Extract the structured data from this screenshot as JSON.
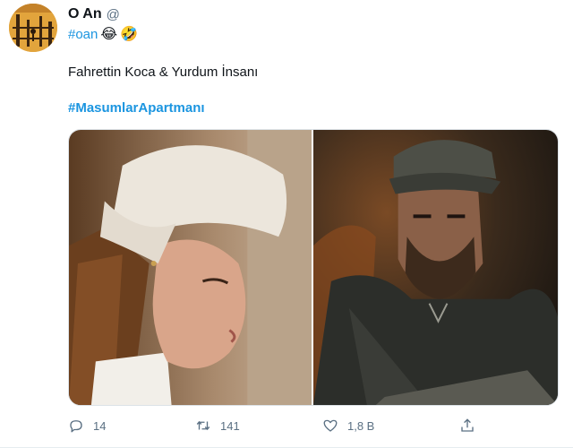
{
  "tweet": {
    "author": {
      "display_name": "O An",
      "handle": "@"
    },
    "header_hashtag": "#oan",
    "emojis": [
      "😂",
      "🤣"
    ],
    "text": "Fahrettin Koca & Yurdum İnsanı",
    "hashtag": "#MasumlarApartmanı",
    "actions": {
      "reply_count": "14",
      "retweet_count": "141",
      "like_count": "1,8 B"
    }
  },
  "colors": {
    "link": "#1b95e0",
    "secondary_text": "#5b7083",
    "primary_text": "#0f1419"
  },
  "icons": {
    "reply": "reply-bubble-icon",
    "retweet": "retweet-arrows-icon",
    "like": "heart-icon",
    "share": "share-upload-icon"
  }
}
